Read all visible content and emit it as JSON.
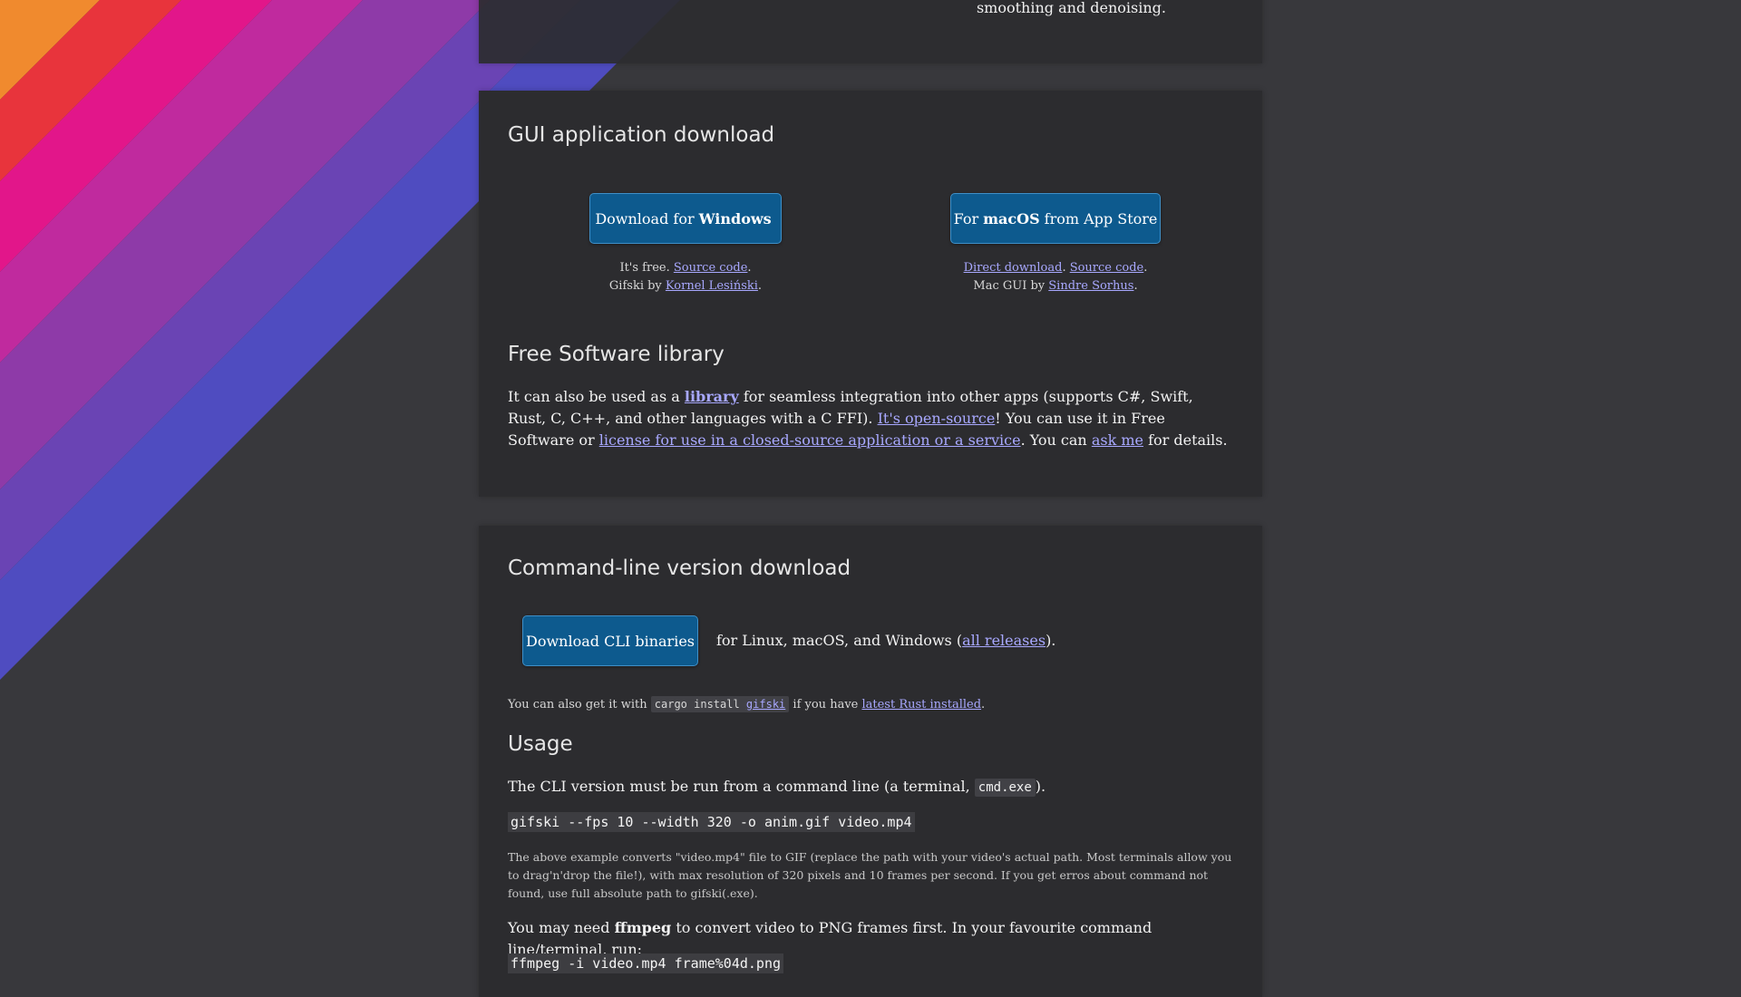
{
  "top_card": {
    "text": "smoothing and denoising."
  },
  "gui": {
    "heading": "GUI application download",
    "windows_button": {
      "prefix": "Download for",
      "bold": "Windows"
    },
    "mac_button": {
      "prefix": "For",
      "bold": "macOS",
      "suffix": "from App Store"
    },
    "windows_note": {
      "line1_text": "It's free. ",
      "line1_link": "Source code",
      "line1_end": ".",
      "line2_text": "Gifski by ",
      "line2_link": "Kornel Lesiński",
      "line2_end": "."
    },
    "mac_note": {
      "link1": "Direct download",
      "sep": ". ",
      "link2": "Source code",
      "line1_end": ".",
      "line2_text": "Mac GUI by ",
      "line2_link": "Sindre Sorhus",
      "line2_end": "."
    }
  },
  "library": {
    "heading": "Free Software library",
    "t1": "It can also be used as a ",
    "link_library": "library",
    "t2": " for seamless integration into other apps (supports C#, Swift, Rust, C, C++, and other languages with a C FFI). ",
    "link_open_source": "It's open-source",
    "t3": "! You can use it in Free Software or ",
    "link_license": "license for use in a closed-source application or a service",
    "t4": ". You can ",
    "link_ask": "ask me",
    "t5": " for details."
  },
  "cli": {
    "heading": "Command-line version download",
    "button": "Download CLI binaries",
    "platforms_text": "for Linux, macOS, and Windows (",
    "platforms_link": "all releases",
    "platforms_end": ").",
    "cargo_t1": "You can also get it with ",
    "cargo_code_a": "cargo install ",
    "cargo_code_link": "gifski",
    "cargo_t2": " if you have ",
    "cargo_link": "latest Rust installed",
    "cargo_end": "."
  },
  "usage": {
    "heading": "Usage",
    "p1_text": "The CLI version must be run from a command line (a terminal, ",
    "p1_code": "cmd.exe",
    "p1_end": ").",
    "command1": "gifski --fps 10 --width 320 -o anim.gif video.mp4",
    "note": "The above example converts \"video.mp4\" file to GIF (replace the path with your video's actual path. Most terminals allow you to drag'n'drop the file!), with max resolution of 320 pixels and 10 frames per second. If you get erros about command not found, use full absolute path to gifski(.exe).",
    "p2_text": "You may need ",
    "p2_bold": "ffmpeg",
    "p2_end": " to convert video to PNG frames first. In your favourite command line/terminal, run:",
    "command2": "ffmpeg -i video.mp4 frame%04d.png"
  },
  "colors": {
    "page_bg": "#38383c",
    "card_bg": "#2c2c2f",
    "button_bg": "#0d5a8e",
    "link": "#a8a8ff"
  }
}
